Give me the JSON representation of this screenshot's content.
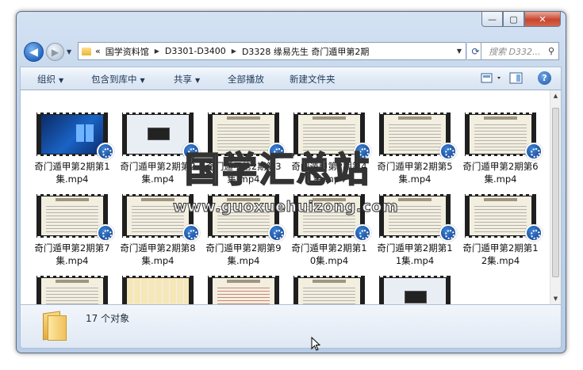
{
  "window": {
    "min": "—",
    "max": "▢",
    "close": "✕"
  },
  "nav": {
    "back": "◀",
    "forward": "▶",
    "drop": "▼"
  },
  "address": {
    "crumbs_prefix": "«",
    "crumbs": [
      "国学资料馆",
      "D3301-D3400",
      "D3328 缘易先生 奇门遁甲第2期"
    ],
    "sep": "▶",
    "drop": "▼",
    "refresh": "⟳"
  },
  "search": {
    "placeholder": "搜索 D332...",
    "icon": "search-icon"
  },
  "toolbar": {
    "organize": "组织",
    "include": "包含到库中",
    "share": "共享",
    "play_all": "全部播放",
    "new_folder": "新建文件夹",
    "arrow": "▼",
    "help": "?"
  },
  "files": [
    {
      "name": "奇门遁甲第2期第1集.mp4",
      "thumb": "win"
    },
    {
      "name": "奇门遁甲第2期第2集.mp4",
      "thumb": "ui"
    },
    {
      "name": "奇门遁甲第2期第3集.mp4",
      "thumb": "doc"
    },
    {
      "name": "奇门遁甲第2期第4集.mp4",
      "thumb": "doc"
    },
    {
      "name": "奇门遁甲第2期第5集.mp4",
      "thumb": "doc"
    },
    {
      "name": "奇门遁甲第2期第6集.mp4",
      "thumb": "doc"
    },
    {
      "name": "奇门遁甲第2期第7集.mp4",
      "thumb": "doc"
    },
    {
      "name": "奇门遁甲第2期第8集.mp4",
      "thumb": "doc"
    },
    {
      "name": "奇门遁甲第2期第9集.mp4",
      "thumb": "doc"
    },
    {
      "name": "奇门遁甲第2期第10集.mp4",
      "thumb": "doc"
    },
    {
      "name": "奇门遁甲第2期第11集.mp4",
      "thumb": "doc"
    },
    {
      "name": "奇门遁甲第2期第12集.mp4",
      "thumb": "doc"
    },
    {
      "name": "",
      "thumb": "doc"
    },
    {
      "name": "",
      "thumb": "grid"
    },
    {
      "name": "",
      "thumb": "red"
    },
    {
      "name": "",
      "thumb": "doc"
    },
    {
      "name": "",
      "thumb": "ui"
    }
  ],
  "watermark": {
    "title": "国学汇总站",
    "url": "www.guoxuehuizong.com"
  },
  "status": {
    "count": "17 个对象"
  },
  "scroll": {
    "up": "▲",
    "down": "▼"
  }
}
